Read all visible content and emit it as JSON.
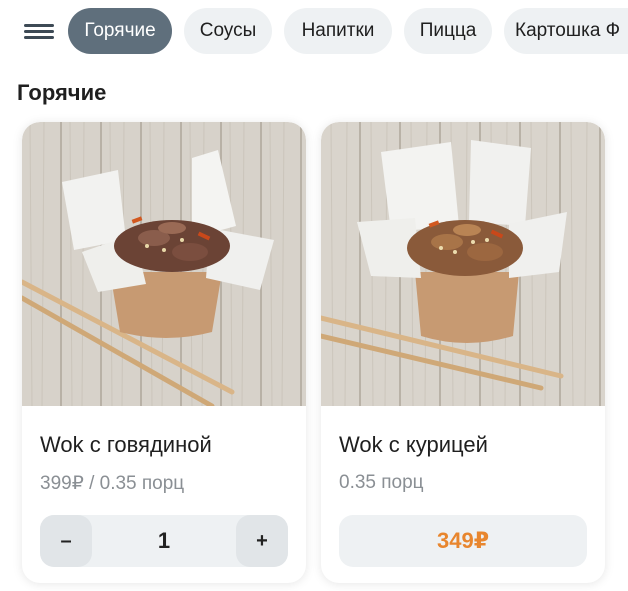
{
  "colors": {
    "chip_active_bg": "#5f6f7c",
    "chip_bg": "#eef1f3",
    "price_accent": "#e8862e",
    "muted_text": "#8a8f94"
  },
  "nav": {
    "menu_icon": "hamburger-menu-icon",
    "chips": [
      {
        "label": "Горячие",
        "active": true
      },
      {
        "label": "Соусы",
        "active": false
      },
      {
        "label": "Напитки",
        "active": false
      },
      {
        "label": "Пицца",
        "active": false
      },
      {
        "label": "Картошка Ф",
        "active": false
      }
    ]
  },
  "section": {
    "title": "Горячие"
  },
  "products": [
    {
      "name": "Wok с говядиной",
      "price_text": "399₽ / 0.35 порц",
      "quantity": "1",
      "minus_label": "–",
      "plus_label": "+"
    },
    {
      "name": "Wok с курицей",
      "price_text": "0.35 порц",
      "button_price": "349₽"
    }
  ]
}
